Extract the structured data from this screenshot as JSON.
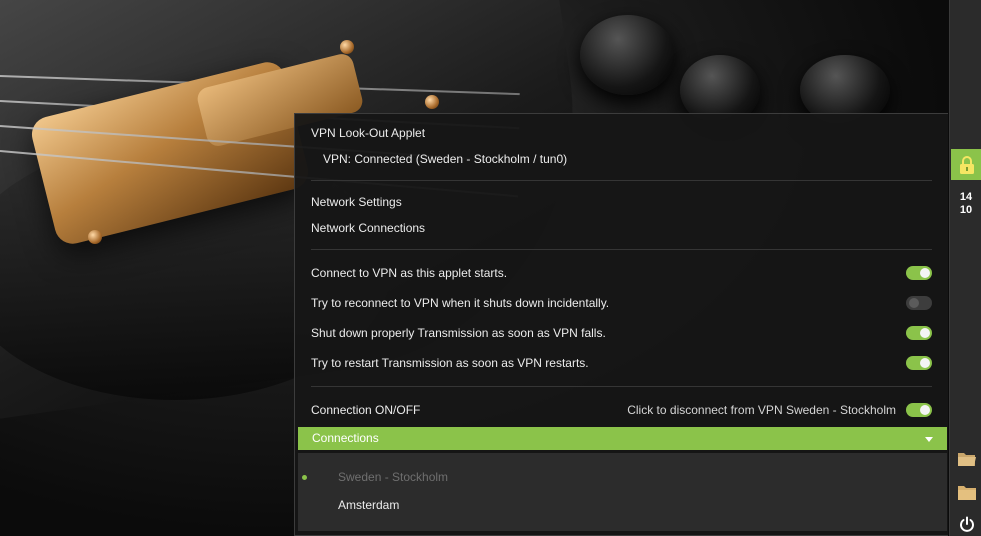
{
  "panel": {
    "clock_hour": "14",
    "clock_minute": "10",
    "icons": [
      "vpn-lock-icon",
      "folder-open-icon",
      "folder-icon",
      "power-icon"
    ]
  },
  "menu": {
    "title": "VPN Look-Out Applet",
    "status": "VPN: Connected (Sweden - Stockholm / tun0)",
    "network_settings": "Network Settings",
    "network_connections": "Network Connections",
    "options": [
      {
        "label": "Connect to VPN as this applet starts.",
        "enabled": true
      },
      {
        "label": "Try to reconnect to VPN when it shuts down incidentally.",
        "enabled": false
      },
      {
        "label": "Shut down properly Transmission as soon as VPN falls.",
        "enabled": true
      },
      {
        "label": "Try to restart Transmission as soon as VPN restarts.",
        "enabled": true
      }
    ],
    "connection_toggle": {
      "label": "Connection ON/OFF",
      "hint": "Click to disconnect from VPN Sweden - Stockholm",
      "enabled": true
    },
    "connections_header": "Connections",
    "connections": [
      {
        "label": "Sweden - Stockholm",
        "active": true
      },
      {
        "label": "Amsterdam",
        "active": false
      }
    ]
  },
  "colors": {
    "accent": "#8bc34a",
    "menu_bg": "#161616",
    "panel_bg": "#2b2b2b"
  }
}
